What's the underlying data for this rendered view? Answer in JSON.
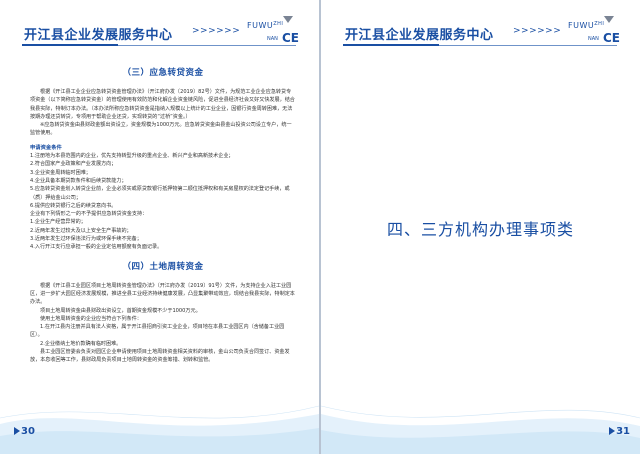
{
  "header": {
    "title": "开江县企业发展服务中心",
    "arrows": ">>>>>>",
    "logo_top": "FUWU",
    "logo_zhi": "ZHI",
    "logo_nan": "NAN",
    "logo_ce": "CE"
  },
  "left_page": {
    "section1_title": "（三）应急转贷资金",
    "p1": "根据《开江县工业企业应急转贷资金管理办法》（开江府办发〔2019〕82号）文件，为规范工业企业应急转贷专项资金（以下简称应急转贷资金）的管理使用有效防范和化解企业资金链风险，促进全县经济社会又好又快发展，结合我县实际，特制订本办法。（本办法所称应急转贷资金是指纳入规模以上统计的工业企业，因银行资金周转困难，无法按期办理还贷转贷，专项用于帮助企业还贷，实现转贷的“过桥”资金。）",
    "p2": "※应急转贷资金由县财政金额出资设立，资金规模为1000万元。应急转贷资金由县金山投资公司设立专户，统一监管使用。",
    "cond_title": "申请资金条件",
    "cond_lines": [
      "1.注册地为本县范围内的企业，优先支持转型升级的重点企业、新兴产业和高新技术企业；",
      "2.符合国家产业政策和产业发展方向；",
      "3.企业资金周转临时困难；",
      "4.企业具备本期贷款条件和后续贷款能力；",
      "5.应急转贷资金划入转贷企业前，企业必须实或原贷款银行抵押物第二顺位抵押权和有关房屋权的法定登记手续，或（质）押给金山公司；",
      "6.提供应转贷银行之后的续贷意向书。",
      "企业有下列情形之一的不予提供应急转贷资金支持：",
      "1.企业生产经营异常的；",
      "2.近两年发生过较大及以上安全生产事故的；",
      "3.近两年发生过环保违法行为或环保手续不完备；",
      "4.入行开江支行应承担一般的企业定信用额度有负面记录。"
    ],
    "section2_title": "（四）土地周转资金",
    "q1": "根据《开江县工业园区项目土地周转资金管理办法》（开江府办发〔2019〕91号）文件，为支持企业入驻工业园区，进一步扩大园区经济发展规模，推进全县工业经济持续健康发展，凸显集聚带动效应，现结合我县实际，特制定本办法。",
    "q2": "项目土地周转资金由县财政出资设立，首期资金规模不少于1000万元。",
    "q3": "使用土地周转资金的企业应当符合下列条件：",
    "q4": "1.在开江县内注册并具有法人资格，属于开江县招商引资工业企业，项目地在本县工业园区内（含储备工业园区）。",
    "q5": "2.企业缴纳土地价款确有临时困难。",
    "q6": "县工业园区管委会负责对园区企业申请使用项目土地周转资金相关资料的审核，金山公司负责合同签订、资金发放，本息收回等工作，县财政局负责项目土地周转资金的资金筹措、划转和监管。",
    "page_number": "30"
  },
  "right_page": {
    "heading": "四、三方机构办理事项类",
    "page_number": "31"
  },
  "colors": {
    "brand_blue": "#1a4fa3",
    "wave_light": "#e4f1fb"
  }
}
